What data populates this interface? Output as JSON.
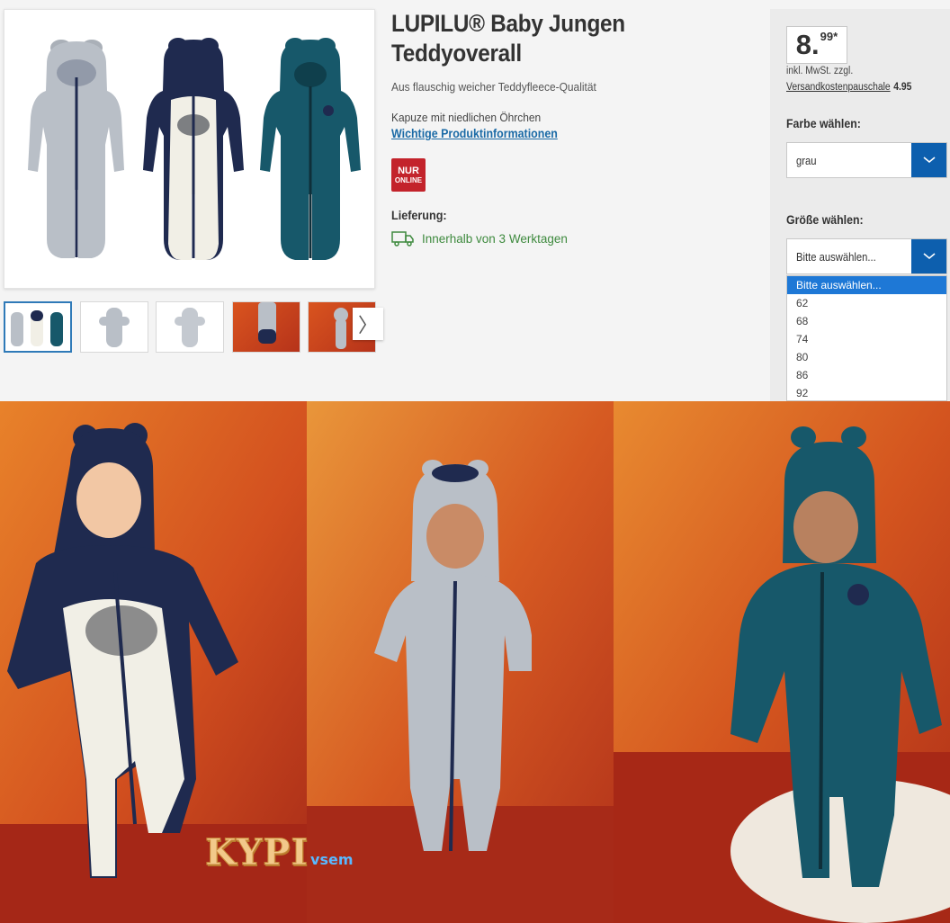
{
  "product": {
    "title": "LUPILU® Baby Jungen Teddyoverall",
    "subtitle": "Aus flauschig weicher Teddyfleece-Qualität",
    "feature": "Kapuze mit niedlichen Öhrchen",
    "info_link": "Wichtige Produktinformationen",
    "badge_line1": "NUR",
    "badge_line2": "ONLINE",
    "badge_color": "#c3232b",
    "delivery_label": "Lieferung:",
    "delivery_text": "Innerhalb von 3 Werktagen",
    "delivery_icon": "truck-icon"
  },
  "gallery": {
    "main_image": "three-teddy-overalls-photo",
    "thumbnails": [
      "three-overalls",
      "grey-overall-front",
      "grey-overall-back",
      "grey-overall-detail",
      "toddler-grey-overall"
    ],
    "next_glyph": "〉"
  },
  "price": {
    "main": "8.",
    "cents": "99*",
    "tax_note": "inkl. MwSt. zzgl.",
    "shipping_link": "Versandkostenpauschale",
    "shipping_amount": "4.95"
  },
  "color_select": {
    "label": "Farbe wählen:",
    "value": "grau"
  },
  "size_select": {
    "label": "Größe wählen:",
    "value": "Bitte auswählen...",
    "options": [
      "Bitte auswählen...",
      "62",
      "68",
      "74",
      "80",
      "86",
      "92"
    ]
  },
  "watermark": {
    "big": "KYPI",
    "small": "vsem"
  },
  "colors": {
    "accent_blue": "#0d5fae",
    "option_highlight": "#1e78d6",
    "link": "#1a6aa6",
    "delivery_green": "#3e8a3e",
    "navy": "#1f2a4f",
    "teal": "#17586a",
    "grey_fleece": "#b9bfc7"
  }
}
